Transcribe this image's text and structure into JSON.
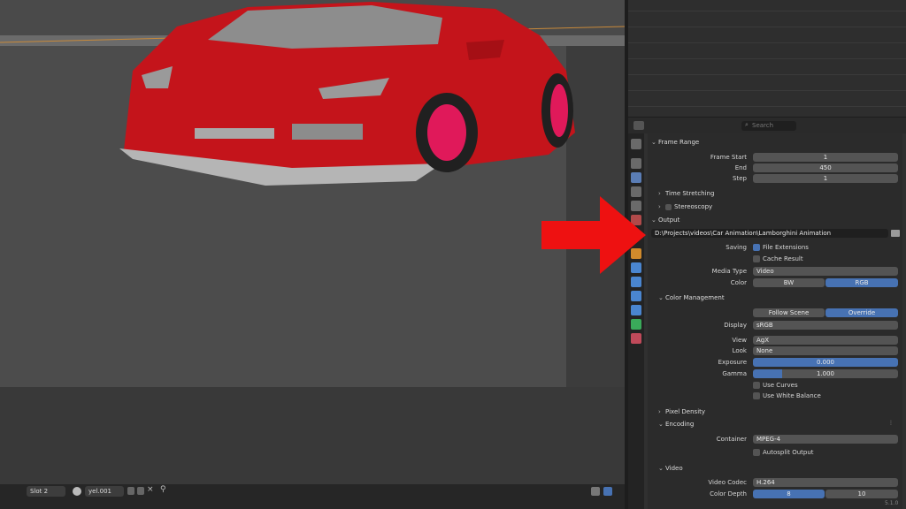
{
  "properties": {
    "search_placeholder": "Search",
    "frame_range": {
      "title": "Frame Range",
      "frame_start_label": "Frame Start",
      "frame_start": "1",
      "end_label": "End",
      "end": "450",
      "step_label": "Step",
      "step": "1"
    },
    "time_stretching": "Time Stretching",
    "stereoscopy": "Stereoscopy",
    "output": {
      "title": "Output",
      "path": "D:\\Projects\\videos\\Car Animation\\Lamborghini Animation",
      "saving_label": "Saving",
      "file_extensions": "File Extensions",
      "cache_result": "Cache Result",
      "media_type_label": "Media Type",
      "media_type": "Video",
      "color_label": "Color",
      "color_bw": "BW",
      "color_rgb": "RGB"
    },
    "color_management": {
      "title": "Color Management",
      "follow_scene": "Follow Scene",
      "override": "Override",
      "display_label": "Display",
      "display": "sRGB",
      "view_label": "View",
      "view": "AgX",
      "look_label": "Look",
      "look": "None",
      "exposure_label": "Exposure",
      "exposure": "0.000",
      "gamma_label": "Gamma",
      "gamma": "1.000",
      "use_curves": "Use Curves",
      "use_white_balance": "Use White Balance"
    },
    "pixel_density": "Pixel Density",
    "encoding": {
      "title": "Encoding",
      "container_label": "Container",
      "container": "MPEG-4",
      "autosplit": "Autosplit Output"
    },
    "video": {
      "title": "Video",
      "codec_label": "Video Codec",
      "codec": "H.264",
      "depth_label": "Color Depth",
      "depth_8": "8",
      "depth_10": "10"
    }
  },
  "statusbar": {
    "slot": "Slot 2",
    "image_name": "yel.001"
  },
  "version": "5.1.0",
  "colors": {
    "accent": "#4772b3",
    "car": "#c4141b",
    "arrow": "#ee1111"
  }
}
